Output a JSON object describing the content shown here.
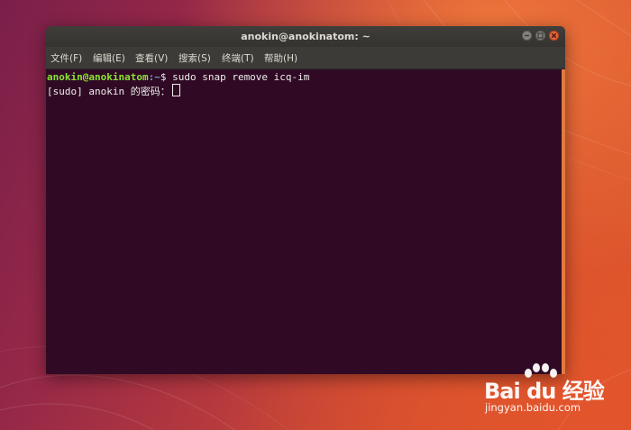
{
  "window": {
    "title": "anokin@anokinatom: ~"
  },
  "menu": {
    "items": [
      {
        "label": "文件(F)"
      },
      {
        "label": "编辑(E)"
      },
      {
        "label": "查看(V)"
      },
      {
        "label": "搜索(S)"
      },
      {
        "label": "终端(T)"
      },
      {
        "label": "帮助(H)"
      }
    ]
  },
  "terminal": {
    "prompt_user": "anokin@anokinatom",
    "prompt_path": ":~",
    "prompt_symbol": "$ ",
    "command": "sudo snap remove icq-im",
    "password_prompt": "[sudo] anokin 的密码："
  },
  "watermark": {
    "brand": "Bai du 经验",
    "url": "jingyan.baidu.com"
  },
  "colors": {
    "terminal_bg": "#300a24",
    "prompt_user": "#8ae234",
    "prompt_path": "#729fcf",
    "close_button": "#e8603a"
  },
  "icons": [
    "minimize-icon",
    "maximize-icon",
    "close-icon",
    "baidu-paw-icon"
  ]
}
